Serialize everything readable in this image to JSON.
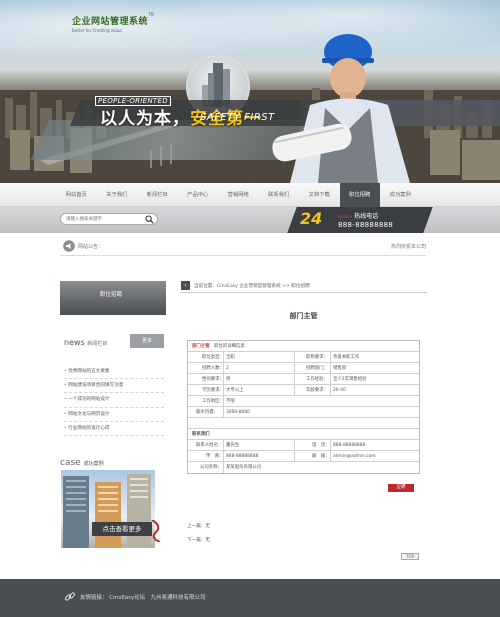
{
  "site": {
    "logo_cn": "企业网站管理系统",
    "logo_en": "Better for Creating value",
    "logo_tm": "TM"
  },
  "banner": {
    "slogan_en1": "PEOPLE-ORIENTED",
    "slogan_cn_a": "以人为本，",
    "slogan_cn_b": "安全第一",
    "slogan_en2": "SAFETY FIRST"
  },
  "nav": {
    "items": [
      {
        "label": "网站首页"
      },
      {
        "label": "关于我们"
      },
      {
        "label": "新闻栏目"
      },
      {
        "label": "产品中心"
      },
      {
        "label": "营销网络"
      },
      {
        "label": "联系我们"
      },
      {
        "label": "文档下载"
      },
      {
        "label": "职位招聘",
        "active": true
      },
      {
        "label": "成功案例"
      }
    ]
  },
  "search": {
    "placeholder": "请输入搜索关键字"
  },
  "hotline": {
    "number_badge": "24",
    "label": "热线电话",
    "label_en": "Hotline",
    "phone": "888-88888888"
  },
  "notice": {
    "label": "网站公告：",
    "message": "热烈庆祝本公司"
  },
  "sidebar": {
    "section_title": "职位招聘",
    "news_title_en": "news",
    "news_title_cn": "新闻栏目",
    "more_label": "更多",
    "news_items": [
      "优秀网站的五大要素",
      "网站建设项目合同填写注意",
      "一个成功的网站设计",
      "网站文化与网页设计",
      "行业网站的设计心得"
    ],
    "case_title_en": "case",
    "case_title_cn": "成功案例",
    "case_button": "点击查看更多"
  },
  "main": {
    "breadcrumb": "当前位置：CmsEasy 企业营销型管理系统  >>  职位招聘",
    "job_title": "部门主管",
    "detail_header_a": "部门主管",
    "detail_header_b": "职位的详细信息",
    "rows": [
      {
        "l1": "职位类型：",
        "v1": "全职",
        "l2": "职称要求：",
        "v2": "热爱本职工作"
      },
      {
        "l1": "招聘人数：",
        "v1": "2",
        "l2": "招聘部门：",
        "v2": "销售部"
      },
      {
        "l1": "性别要求：",
        "v1": "男",
        "l2": "工作经验：",
        "v2": "至少2年销售经验"
      },
      {
        "l1": "学历要求：",
        "v1": "大专以上",
        "l2": "年龄要求：",
        "v2": "20-40"
      },
      {
        "l1": "工作地区：",
        "v1": "不限"
      },
      {
        "l1": "薪水待遇：",
        "v1": "3000-8000"
      }
    ],
    "contact_header": "联系我们",
    "contact_rows": [
      {
        "l1": "联系人姓名：",
        "v1": "董先生",
        "l2": "电　话：",
        "v2": "888-88888888"
      },
      {
        "l1": "传　真：",
        "v1": "888-88888888",
        "l2": "邮　箱：",
        "v2": "admin@admin.com"
      },
      {
        "l1": "公司名称：",
        "v1": "某某股份有限公司"
      }
    ],
    "apply_button": "应聘",
    "prev": "上一篇：无",
    "next": "下一篇：无",
    "top_button": "TOP"
  },
  "footer": {
    "label": "友情链接：",
    "link1": "CmsEasy论坛",
    "link2": "九州易通科技有限公司"
  },
  "colors": {
    "dark_gray": "#4a4d52",
    "accent_red": "#c0282d",
    "hotline_yellow": "#f5c518",
    "logo_green": "#3a6b22"
  }
}
